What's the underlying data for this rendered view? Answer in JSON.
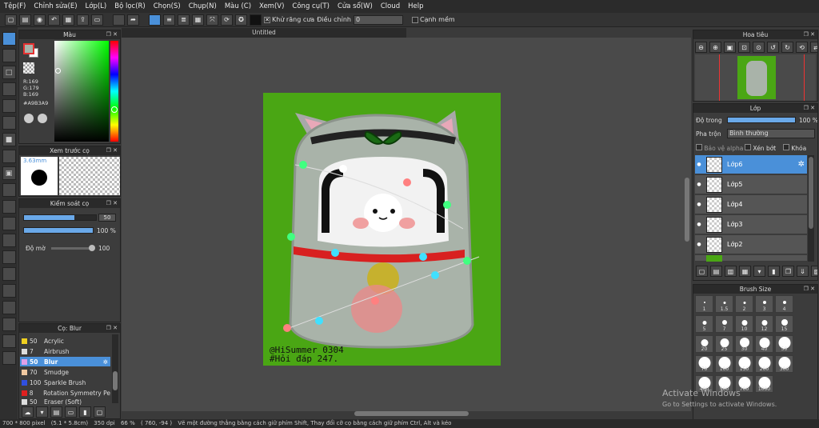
{
  "menu": [
    "Tệp(F)",
    "Chỉnh sửa(E)",
    "Lớp(L)",
    "Bộ lọc(R)",
    "Chọn(S)",
    "Chụp(N)",
    "Màu (C)",
    "Xem(V)",
    "Công cụ(T)",
    "Cửa sổ(W)",
    "Cloud",
    "Help"
  ],
  "toolbar": {
    "antialias_label": "Khử răng cưa",
    "antialias_checked": "✕",
    "adjust_label": "Điều chỉnh",
    "adjust_value": "0",
    "snap_label": "Cạnh mềm"
  },
  "color_panel": {
    "title": "Màu",
    "r": "R:169",
    "g": "G:179",
    "b": "B:169",
    "hex_text": "#A9B3A9",
    "fg_color": "#a9b3a9"
  },
  "preview_panel": {
    "title": "Xem trước cọ",
    "size": "3.63mm"
  },
  "control_panel": {
    "title": "Kiểm soát cọ",
    "size_value": "50",
    "opacity_value": "100 %",
    "blur_label": "Độ mờ",
    "blur_value": "100",
    "size_fraction": 0.7,
    "opacity_fraction": 1.0
  },
  "brush_panel": {
    "title": "Cọ: Blur",
    "items": [
      {
        "num": "50",
        "name": "Acrylic",
        "color": "#f0d020"
      },
      {
        "num": "7",
        "name": "Airbrush",
        "color": "#dddddd"
      },
      {
        "num": "50",
        "name": "Blur",
        "color": "#e0a0e8"
      },
      {
        "num": "70",
        "name": "Smudge",
        "color": "#f0c8a0"
      },
      {
        "num": "100",
        "name": "Sparkle Brush",
        "color": "#3050e0"
      },
      {
        "num": "8",
        "name": "Rotation Symmetry Pe",
        "color": "#e02020"
      },
      {
        "num": "50",
        "name": "Eraser (Soft)",
        "color": "#dddddd"
      }
    ]
  },
  "canvas": {
    "tab": "Untitled",
    "signature_line1": "@HiSummer 0304",
    "signature_line2": "#Hỏi đáp 247."
  },
  "navigator": {
    "title": "Hoa tiêu"
  },
  "layer_panel": {
    "title": "Lớp",
    "opacity_label": "Độ trong",
    "opacity_value": "100 %",
    "blend_label": "Pha trộn",
    "blend_value": "Bình thường",
    "alpha_protect": "Bảo vệ alpha",
    "clipping": "Xén bớt",
    "lock": "Khóa",
    "layers": [
      "Lớp6",
      "Lớp5",
      "Lớp4",
      "Lớp3",
      "Lớp2"
    ]
  },
  "brush_size_panel": {
    "title": "Brush Size",
    "sizes": [
      "1",
      "1.5",
      "2",
      "3",
      "4",
      "5",
      "7",
      "10",
      "12",
      "15",
      "20",
      "25",
      "30",
      "40",
      "50",
      "70",
      "100",
      "150",
      "200",
      "300",
      "400",
      "500",
      "700",
      "1000"
    ]
  },
  "status": {
    "pixels": "700 * 800 pixel",
    "cm": "(5.1 * 5.8cm)",
    "dpi": "350 dpi",
    "zoom": "66 %",
    "coords": "( 760, -94 )",
    "hint": "Vẽ một đường thẳng bằng cách giữ phím Shift, Thay đổi cỡ cọ bằng cách giữ phím Ctrl, Alt và kéo"
  },
  "watermark": {
    "line1": "Activate Windows",
    "line2": "Go to Settings to activate Windows."
  }
}
